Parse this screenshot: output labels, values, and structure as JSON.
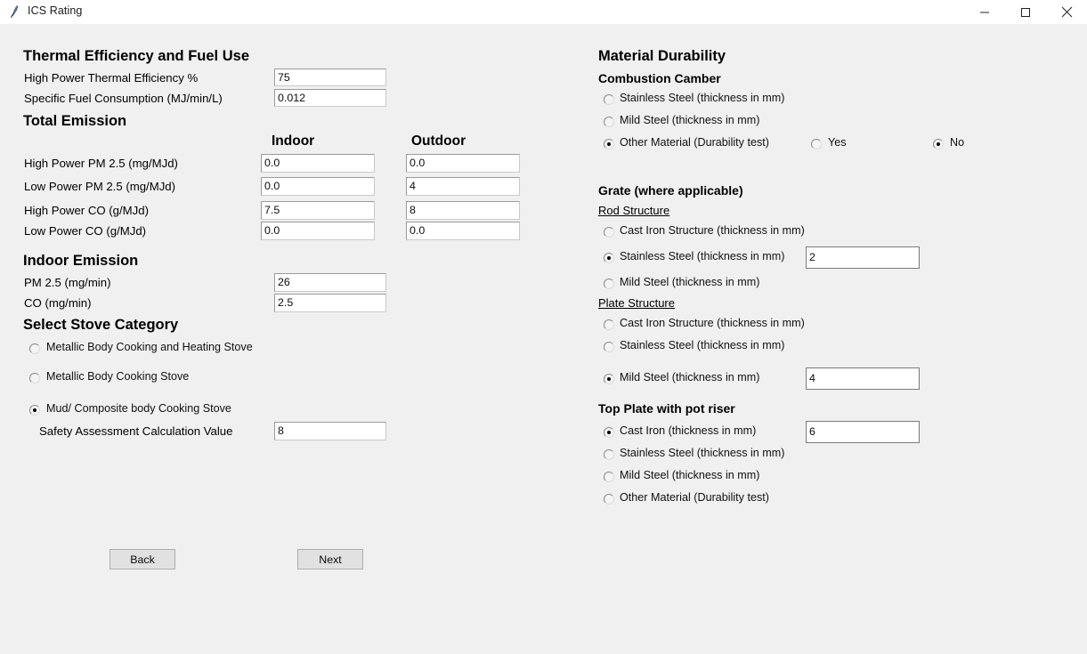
{
  "window": {
    "title": "ICS Rating",
    "icon": "matlab-feather-icon",
    "controls": {
      "minimize": "minimize-icon",
      "maximize": "maximize-icon",
      "close": "close-icon"
    }
  },
  "colors": {
    "surface": "#f0f0f0",
    "titlebar": "#ffffff",
    "field": "#ffffff",
    "field_border": "#9a9a9a",
    "button_face": "#e1e1e1",
    "button_border": "#adadad",
    "text": "#000000"
  },
  "left": {
    "thermal": {
      "heading": "Thermal Efficiency and Fuel Use",
      "fields": [
        {
          "label": "High Power Thermal Efficiency %",
          "value": "75"
        },
        {
          "label": "Specific Fuel Consumption (MJ/min/L)",
          "value": "0.012"
        }
      ]
    },
    "total_emission": {
      "heading": "Total Emission",
      "columns": [
        "Indoor",
        "Outdoor"
      ],
      "rows": [
        {
          "label": "High Power PM 2.5 (mg/MJd)",
          "indoor": "0.0",
          "outdoor": "0.0"
        },
        {
          "label": "Low Power PM 2.5 (mg/MJd)",
          "indoor": "0.0",
          "outdoor": "4"
        },
        {
          "label": "High Power CO (g/MJd)",
          "indoor": "7.5",
          "outdoor": "8"
        },
        {
          "label": "Low Power CO (g/MJd)",
          "indoor": "0.0",
          "outdoor": "0.0"
        }
      ]
    },
    "indoor_emission": {
      "heading": "Indoor Emission",
      "fields": [
        {
          "label": "PM 2.5 (mg/min)",
          "value": "26"
        },
        {
          "label": "CO (mg/min)",
          "value": "2.5"
        }
      ]
    },
    "stove_category": {
      "heading": "Select Stove Category",
      "options": [
        {
          "label": "Metallic Body Cooking and Heating Stove",
          "selected": false
        },
        {
          "label": "Metallic Body Cooking Stove",
          "selected": false
        },
        {
          "label": "Mud/ Composite body Cooking Stove",
          "selected": true
        }
      ],
      "safety": {
        "label": "Safety Assessment Calculation Value",
        "value": "8"
      }
    },
    "buttons": {
      "back": "Back",
      "next": "Next"
    }
  },
  "right": {
    "heading": "Material Durability",
    "combustion_chamber": {
      "heading": "Combustion Camber",
      "options": [
        {
          "label": "Stainless Steel (thickness in mm)",
          "selected": false
        },
        {
          "label": "Mild Steel (thickness in mm)",
          "selected": false
        },
        {
          "label": "Other Material (Durability test)",
          "selected": true
        }
      ],
      "durability_test": {
        "yes": {
          "label": "Yes",
          "selected": false
        },
        "no": {
          "label": "No",
          "selected": true
        }
      }
    },
    "grate": {
      "heading": "Grate (where applicable)",
      "rod_structure": {
        "heading": "Rod Structure",
        "options": [
          {
            "label": "Cast Iron Structure (thickness in mm)",
            "selected": false,
            "value": ""
          },
          {
            "label": "Stainless Steel (thickness in mm)",
            "selected": true,
            "value": "2"
          },
          {
            "label": "Mild Steel (thickness in mm)",
            "selected": false,
            "value": ""
          }
        ]
      },
      "plate_structure": {
        "heading": "Plate Structure",
        "options": [
          {
            "label": "Cast Iron Structure (thickness in mm)",
            "selected": false,
            "value": ""
          },
          {
            "label": "Stainless Steel (thickness in mm)",
            "selected": false,
            "value": ""
          },
          {
            "label": "Mild Steel (thickness in mm)",
            "selected": true,
            "value": "4"
          }
        ]
      }
    },
    "top_plate": {
      "heading": "Top Plate with pot riser",
      "options": [
        {
          "label": "Cast Iron (thickness in mm)",
          "selected": true,
          "value": "6"
        },
        {
          "label": "Stainless Steel (thickness in mm)",
          "selected": false,
          "value": ""
        },
        {
          "label": "Mild Steel (thickness in mm)",
          "selected": false,
          "value": ""
        },
        {
          "label": "Other Material (Durability test)",
          "selected": false,
          "value": ""
        }
      ]
    }
  }
}
